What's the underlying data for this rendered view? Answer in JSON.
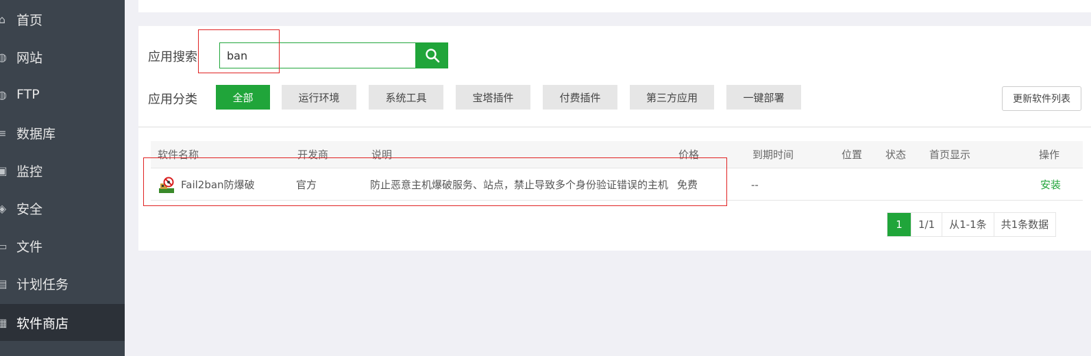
{
  "sidebar": {
    "items": [
      {
        "label": "首页",
        "icon": "home-icon",
        "glyph": "⌂"
      },
      {
        "label": "网站",
        "icon": "globe-icon",
        "glyph": "◍"
      },
      {
        "label": "FTP",
        "icon": "globe-icon",
        "glyph": "◍"
      },
      {
        "label": "数据库",
        "icon": "database-icon",
        "glyph": "≡"
      },
      {
        "label": "监控",
        "icon": "monitor-icon",
        "glyph": "▣"
      },
      {
        "label": "安全",
        "icon": "shield-icon",
        "glyph": "◈"
      },
      {
        "label": "文件",
        "icon": "folder-icon",
        "glyph": "▭"
      },
      {
        "label": "计划任务",
        "icon": "calendar-icon",
        "glyph": "▤"
      },
      {
        "label": "软件商店",
        "icon": "apps-icon",
        "glyph": "▦",
        "active": true
      }
    ]
  },
  "search": {
    "label": "应用搜索",
    "value": "ban",
    "button_icon": "search-icon"
  },
  "categories": {
    "label": "应用分类",
    "items": [
      "全部",
      "运行环境",
      "系统工具",
      "宝塔插件",
      "付费插件",
      "第三方应用",
      "一键部署"
    ],
    "active_index": 0
  },
  "refresh_button": "更新软件列表",
  "table": {
    "headers": [
      "软件名称",
      "开发商",
      "说明",
      "价格",
      "到期时间",
      "位置",
      "状态",
      "首页显示",
      "操作"
    ],
    "rows": [
      {
        "name": "Fail2ban防爆破",
        "icon": "fail2ban-icon",
        "developer": "官方",
        "description": "防止恶意主机爆破服务、站点，禁止导致多个身份验证错误的主机",
        "price": "免费",
        "expiry": "--",
        "location": "",
        "status": "",
        "homepage": "",
        "action": "安装"
      }
    ]
  },
  "pagination": {
    "current": "1",
    "pages": "1/1",
    "range": "从1-1条",
    "total": "共1条数据"
  },
  "colors": {
    "accent": "#20a53a",
    "sidebar_bg": "#3c444d",
    "annotation": "#e02020"
  }
}
